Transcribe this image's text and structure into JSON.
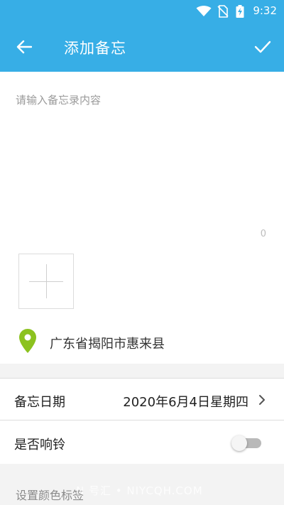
{
  "status_bar": {
    "time": "9:32",
    "icons": [
      "wifi-icon",
      "no-sim-icon",
      "battery-charging-icon"
    ]
  },
  "app_bar": {
    "title": "添加备忘",
    "back_icon": "arrow-left-icon",
    "confirm_icon": "check-icon",
    "color": "#37aee6"
  },
  "memo": {
    "placeholder": "请输入备忘录内容",
    "value": "",
    "char_count": "0"
  },
  "photo": {
    "add_icon": "plus-icon"
  },
  "location": {
    "icon": "location-pin-icon",
    "icon_color": "#8cc21f",
    "text": "广东省揭阳市惠来县"
  },
  "date_row": {
    "label": "备忘日期",
    "value": "2020年6月4日星期四",
    "icon": "chevron-right-icon"
  },
  "bell_row": {
    "label": "是否响铃",
    "enabled": false
  },
  "color_tag": {
    "label": "设置颜色标签"
  },
  "watermark": "N 号汇 • NIYCQH.COM"
}
